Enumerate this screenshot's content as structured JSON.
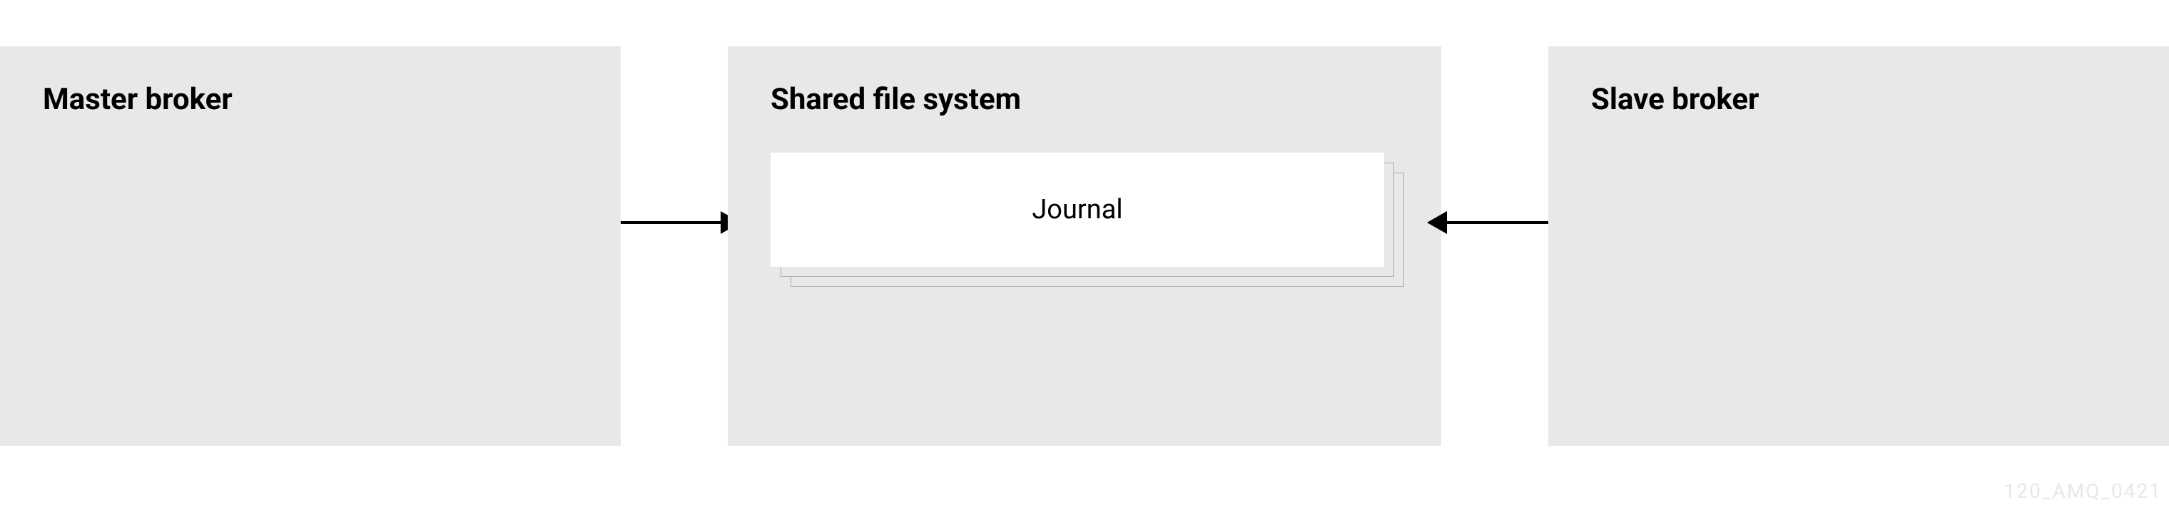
{
  "boxes": {
    "master": {
      "title": "Master broker"
    },
    "shared": {
      "title": "Shared file system",
      "journal_label": "Journal"
    },
    "slave": {
      "title": "Slave broker"
    }
  },
  "watermark": "120_AMQ_0421"
}
